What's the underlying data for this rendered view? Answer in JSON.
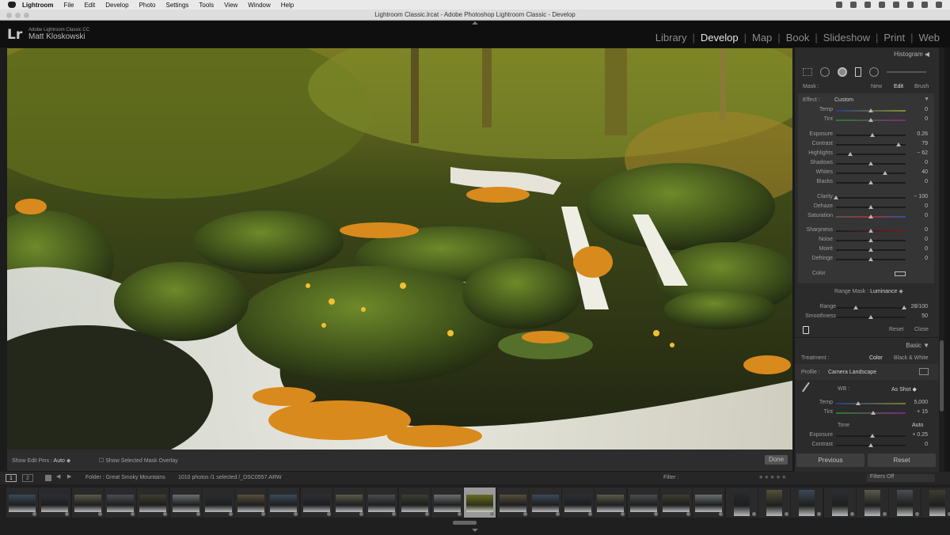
{
  "menubar": {
    "items": [
      "Lightroom",
      "File",
      "Edit",
      "Develop",
      "Photo",
      "Settings",
      "Tools",
      "View",
      "Window",
      "Help"
    ]
  },
  "window": {
    "title": "Lightroom Classic.lrcat - Adobe Photoshop Lightroom Classic - Develop"
  },
  "identity": {
    "logo": "Lr",
    "app": "Adobe Lightroom Classic CC",
    "user": "Matt Kloskowski"
  },
  "modules": [
    "Library",
    "Develop",
    "Map",
    "Book",
    "Slideshow",
    "Print",
    "Web"
  ],
  "active_module": "Develop",
  "toolbar": {
    "edit_pins_label": "Show Edit Pins :",
    "edit_pins_value": "Auto",
    "mask_overlay_label": "Show Selected Mask Overlay",
    "done_label": "Done"
  },
  "right_panel": {
    "histogram_title": "Histogram",
    "mask": {
      "label": "Mask :",
      "new": "New",
      "edit": "Edit",
      "brush": "Brush"
    },
    "effect": {
      "label": "Effect :",
      "value": "Custom"
    },
    "sliders_group1": [
      {
        "label": "Temp",
        "value": "0",
        "pos": 0.5
      },
      {
        "label": "Tint",
        "value": "0",
        "pos": 0.5
      }
    ],
    "sliders_group2": [
      {
        "label": "Exposure",
        "value": "0.26",
        "pos": 0.52
      },
      {
        "label": "Contrast",
        "value": "79",
        "pos": 0.9
      },
      {
        "label": "Highlights",
        "value": "− 62",
        "pos": 0.2
      },
      {
        "label": "Shadows",
        "value": "0",
        "pos": 0.5
      },
      {
        "label": "Whites",
        "value": "40",
        "pos": 0.7
      },
      {
        "label": "Blacks",
        "value": "0",
        "pos": 0.5
      }
    ],
    "sliders_group3": [
      {
        "label": "Clarity",
        "value": "− 100",
        "pos": 0.0
      },
      {
        "label": "Dehaze",
        "value": "0",
        "pos": 0.5
      },
      {
        "label": "Saturation",
        "value": "0",
        "pos": 0.5
      }
    ],
    "sliders_group4": [
      {
        "label": "Sharpness",
        "value": "0",
        "pos": 0.5
      },
      {
        "label": "Noise",
        "value": "0",
        "pos": 0.5
      },
      {
        "label": "Moiré",
        "value": "0",
        "pos": 0.5
      },
      {
        "label": "Defringe",
        "value": "0",
        "pos": 0.5
      }
    ],
    "color_label": "Color",
    "range_mask": {
      "label": "Range Mask :",
      "value": "Luminance"
    },
    "range": {
      "label": "Range",
      "value": "28/100"
    },
    "smoothness": {
      "label": "Smoothness",
      "value": "50",
      "pos": 0.5
    },
    "reset": "Reset",
    "close": "Close",
    "basic_title": "Basic",
    "treatment": {
      "label": "Treatment :",
      "color": "Color",
      "bw": "Black & White"
    },
    "profile": {
      "label": "Profile :",
      "value": "Camera Landscape"
    },
    "wb": {
      "label": "WB :",
      "value": "As Shot"
    },
    "wb_temp": {
      "label": "Temp",
      "value": "5,000",
      "pos": 0.32
    },
    "wb_tint": {
      "label": "Tint",
      "value": "+ 15",
      "pos": 0.53
    },
    "tone": {
      "label": "Tone",
      "auto": "Auto"
    },
    "tone_sliders": [
      {
        "label": "Exposure",
        "value": "+ 0.25",
        "pos": 0.52
      },
      {
        "label": "Contrast",
        "value": "0",
        "pos": 0.5
      }
    ],
    "previous": "Previous",
    "reset_btn": "Reset"
  },
  "filmbar": {
    "page1": "1",
    "page2": "2",
    "folder": "Folder : Great Smoky Mountains",
    "count": "1010 photos /1 selected /_DSC0557.ARW",
    "filter_label": "Filter :",
    "filters_off": "Filters Off"
  },
  "filmstrip": {
    "count": 29,
    "selected_index": 14
  },
  "colors": {
    "accent": "#e6e6e6",
    "panel": "#2b2b2b",
    "background": "#1a1a1a"
  }
}
